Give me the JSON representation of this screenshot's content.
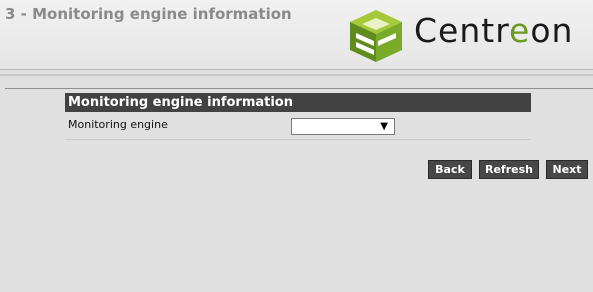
{
  "header": {
    "step_title": "3 - Monitoring engine information",
    "logo_text_pre": "Centr",
    "logo_text_accent": "e",
    "logo_text_post": "on",
    "logo_icon": "centreon-cube-icon",
    "colors": {
      "logo_green": "#6a9a1f",
      "logo_light_green": "#a6c93a",
      "header_bg": "#eeeeee",
      "page_bg": "#e0e0e0"
    }
  },
  "panel": {
    "title": "Monitoring engine information",
    "fields": [
      {
        "label": "Monitoring engine",
        "value": ""
      }
    ]
  },
  "buttons": {
    "back": "Back",
    "refresh": "Refresh",
    "next": "Next"
  },
  "colors": {
    "panel_header_bg": "#424242",
    "button_bg": "#474747"
  }
}
